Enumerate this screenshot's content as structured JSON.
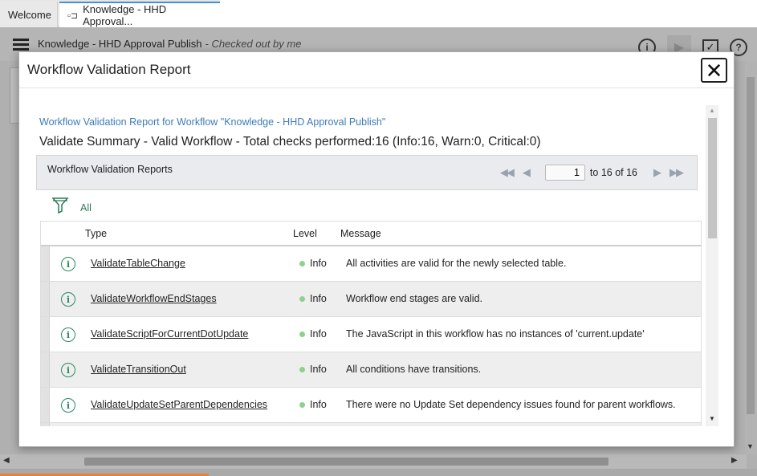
{
  "tabs": [
    {
      "label": "Welcome"
    },
    {
      "label": "Knowledge - HHD Approval..."
    }
  ],
  "appbar": {
    "title": "Knowledge - HHD Approval Publish",
    "subtitle": "- Checked out by me"
  },
  "modal": {
    "title": "Workflow Validation Report",
    "close_glyph": "✕",
    "report_link": "Workflow Validation Report for Workflow \"Knowledge - HHD Approval Publish\"",
    "summary": "Validate Summary - Valid Workflow - Total checks performed:16 (Info:16, Warn:0, Critical:0)",
    "list_label": "Workflow Validation Reports",
    "pager": {
      "page": "1",
      "range": "to 16 of 16"
    },
    "filter_label": "All",
    "columns": {
      "type": "Type",
      "level": "Level",
      "message": "Message"
    },
    "rows": [
      {
        "type": "ValidateTableChange",
        "level": "Info",
        "message": "All activities are valid for the newly selected table."
      },
      {
        "type": "ValidateWorkflowEndStages",
        "level": "Info",
        "message": "Workflow end stages are valid."
      },
      {
        "type": "ValidateScriptForCurrentDotUpdate",
        "level": "Info",
        "message": "The JavaScript in this workflow has no instances of 'current.update'"
      },
      {
        "type": "ValidateTransitionOut",
        "level": "Info",
        "message": "All conditions have transitions."
      },
      {
        "type": "ValidateUpdateSetParentDependencies",
        "level": "Info",
        "message": "There were no Update Set dependency issues found for parent workflows."
      }
    ]
  },
  "colors": {
    "link_blue": "#3d7bb8",
    "info_green": "#2a8a5e",
    "info_dot": "#8fd18a",
    "accent_orange": "#e8803a"
  }
}
